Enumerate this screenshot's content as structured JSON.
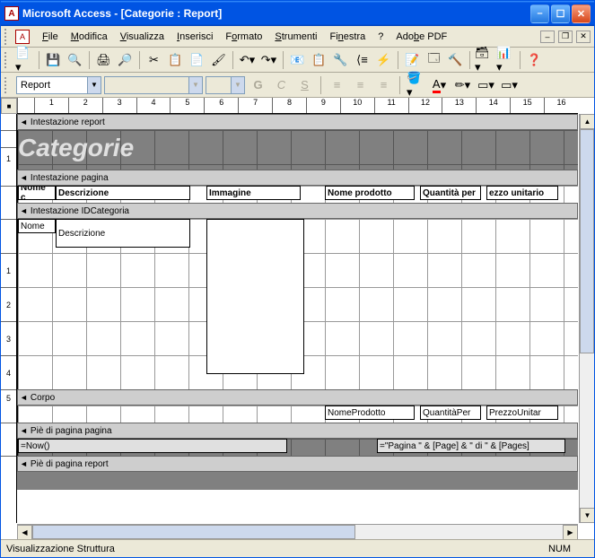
{
  "titlebar": {
    "text": "Microsoft Access - [Categorie : Report]"
  },
  "menu": {
    "file": "File",
    "edit": "Modifica",
    "view": "Visualizza",
    "insert": "Inserisci",
    "format": "Formato",
    "tools": "Strumenti",
    "window": "Finestra",
    "help": "?",
    "adobe": "Adobe PDF"
  },
  "toolbar2": {
    "object_selector": "Report"
  },
  "format_buttons": {
    "g": "G",
    "c": "C",
    "s": "S"
  },
  "ruler_h": [
    "1",
    "2",
    "3",
    "4",
    "5",
    "6",
    "7",
    "8",
    "9",
    "10",
    "11",
    "12",
    "13",
    "14",
    "15",
    "16"
  ],
  "ruler_v_header": [
    "",
    "1"
  ],
  "ruler_v_detail": [
    "",
    "1",
    "2",
    "3",
    "4",
    "5"
  ],
  "sections": {
    "report_header": "Intestazione report",
    "page_header": "Intestazione pagina",
    "group_header": "Intestazione IDCategoria",
    "detail": "Corpo",
    "page_footer": "Piè di pagina pagina",
    "report_footer": "Piè di pagina report"
  },
  "report_header_title": "Categorie",
  "page_header_labels": {
    "name": "Nome c",
    "desc": "Descrizione",
    "image": "Immagine",
    "product": "Nome prodotto",
    "qty": "Quantità per",
    "price": "ezzo unitario"
  },
  "group_fields": {
    "name": "Nome",
    "desc": "Descrizione"
  },
  "detail_fields": {
    "product": "NomeProdotto",
    "qty": "QuantitàPer",
    "price": "PrezzoUnitar"
  },
  "page_footer_fields": {
    "now": "=Now()",
    "page": "=\"Pagina \" & [Page] & \" di \" & [Pages]"
  },
  "statusbar": {
    "text": "Visualizzazione Struttura",
    "num": "NUM"
  }
}
